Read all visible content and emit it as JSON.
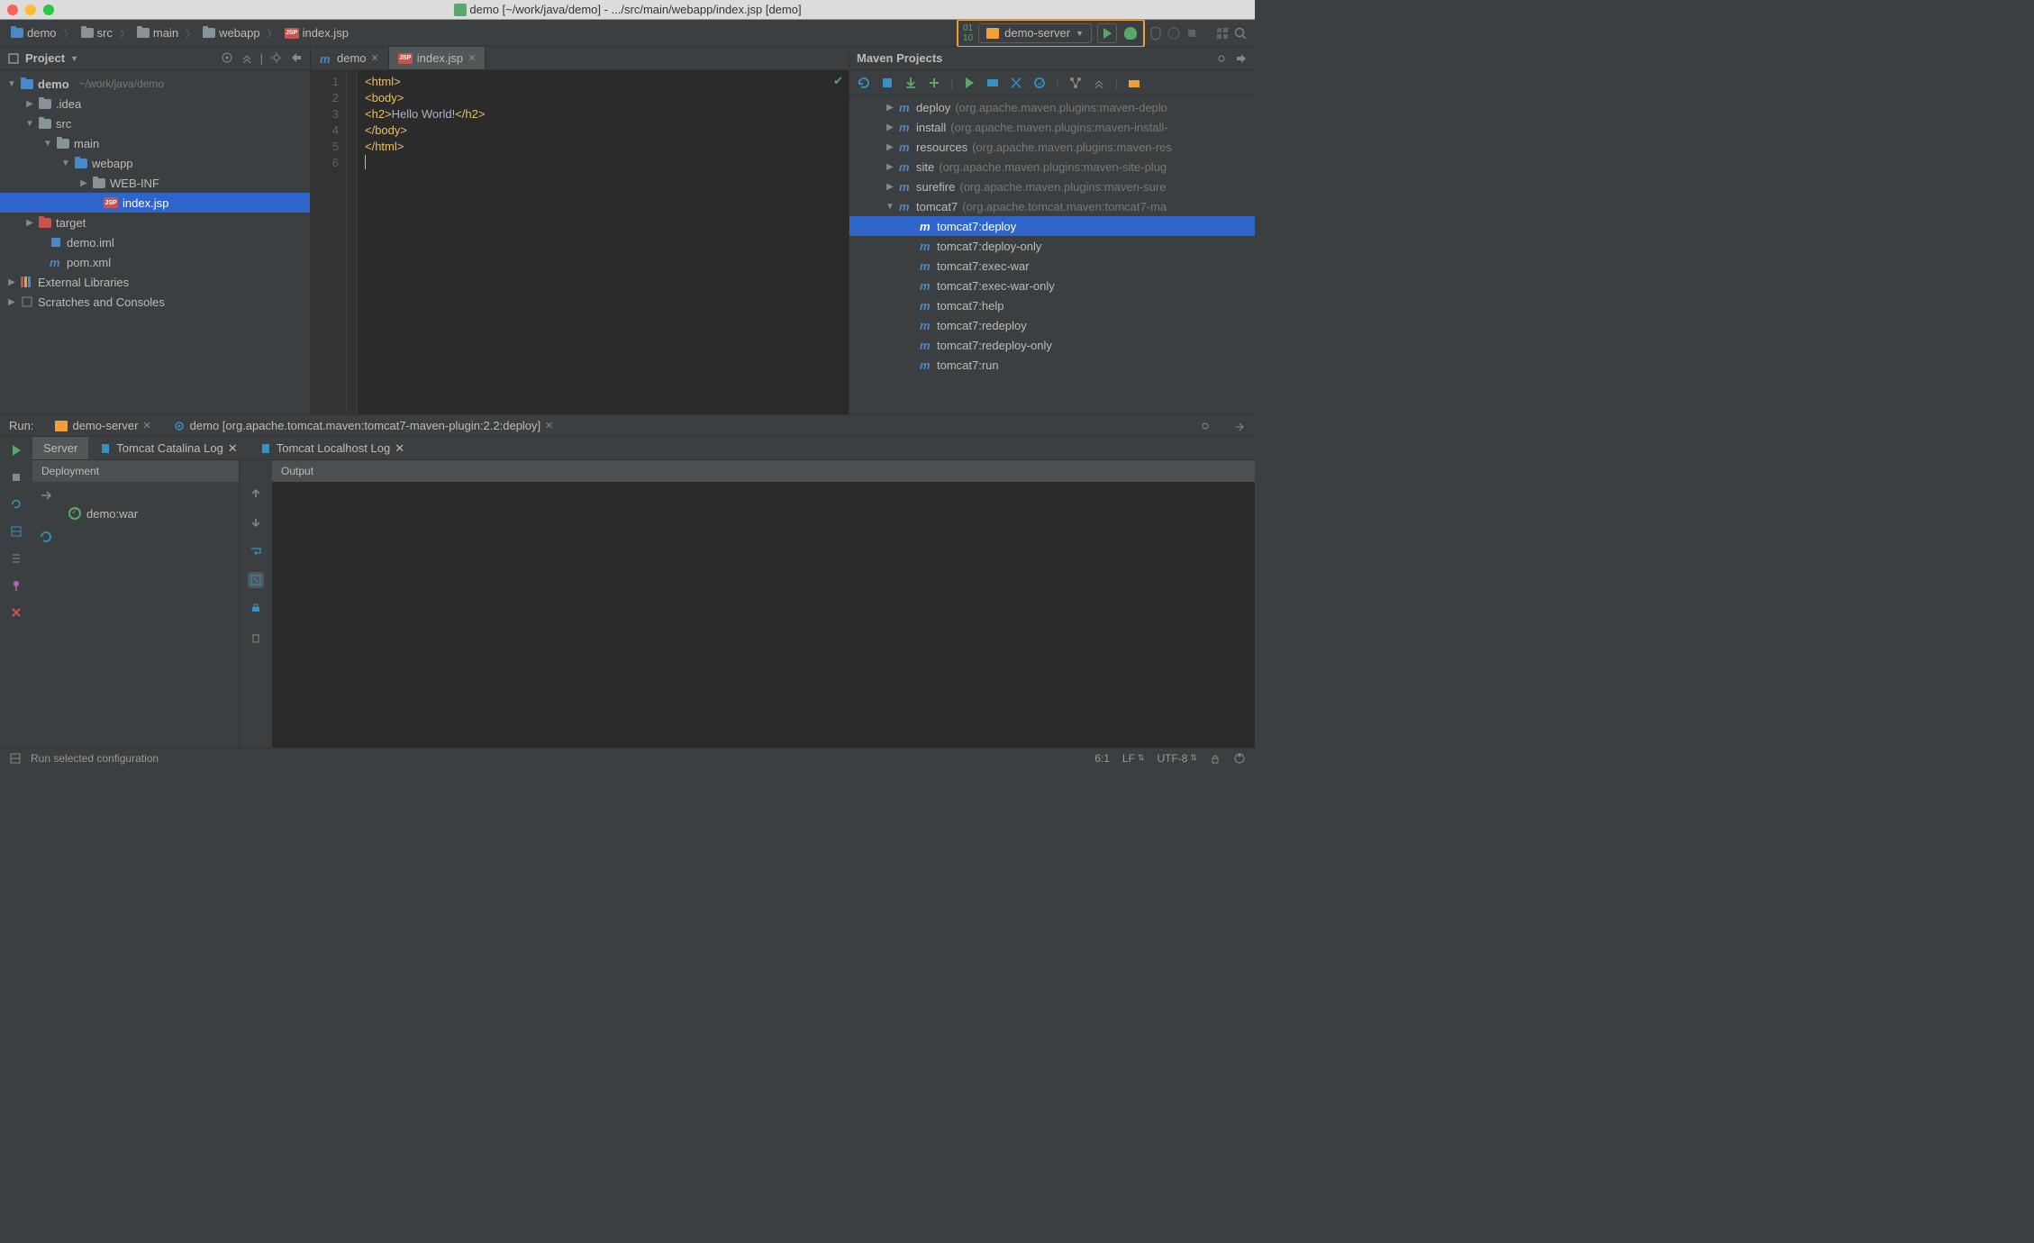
{
  "title": "demo [~/work/java/demo] - .../src/main/webapp/index.jsp [demo]",
  "breadcrumbs": [
    "demo",
    "src",
    "main",
    "webapp",
    "index.jsp"
  ],
  "run_config": {
    "name": "demo-server"
  },
  "project_panel": {
    "title": "Project",
    "tree": {
      "root": {
        "label": "demo",
        "path": "~/work/java/demo"
      },
      "idea": ".idea",
      "src": "src",
      "main": "main",
      "webapp": "webapp",
      "webinf": "WEB-INF",
      "indexjsp": "index.jsp",
      "target": "target",
      "demoiml": "demo.iml",
      "pom": "pom.xml",
      "extlib": "External Libraries",
      "scratches": "Scratches and Consoles"
    }
  },
  "editor": {
    "tabs": [
      {
        "label": "demo",
        "icon": "m"
      },
      {
        "label": "index.jsp",
        "icon": "jsp",
        "active": true
      }
    ],
    "lines": [
      {
        "n": 1,
        "html": "<html>"
      },
      {
        "n": 2,
        "html": "<body>"
      },
      {
        "n": 3,
        "pre": "<h2>",
        "text": "Hello World!",
        "post": "</h2>"
      },
      {
        "n": 4,
        "html": "</body>"
      },
      {
        "n": 5,
        "html": "</html>"
      },
      {
        "n": 6,
        "html": ""
      }
    ]
  },
  "maven": {
    "title": "Maven Projects",
    "items": [
      {
        "name": "deploy",
        "goal": "(org.apache.maven.plugins:maven-deplo"
      },
      {
        "name": "install",
        "goal": "(org.apache.maven.plugins:maven-install-"
      },
      {
        "name": "resources",
        "goal": "(org.apache.maven.plugins:maven-res"
      },
      {
        "name": "site",
        "goal": "(org.apache.maven.plugins:maven-site-plug"
      },
      {
        "name": "surefire",
        "goal": "(org.apache.maven.plugins:maven-sure"
      }
    ],
    "tomcat": {
      "name": "tomcat7",
      "goal": "(org.apache.tomcat.maven:tomcat7-ma"
    },
    "tomcat_goals": [
      "tomcat7:deploy",
      "tomcat7:deploy-only",
      "tomcat7:exec-war",
      "tomcat7:exec-war-only",
      "tomcat7:help",
      "tomcat7:redeploy",
      "tomcat7:redeploy-only",
      "tomcat7:run"
    ]
  },
  "run": {
    "label": "Run:",
    "tabs": [
      {
        "label": "demo-server"
      },
      {
        "label": "demo [org.apache.tomcat.maven:tomcat7-maven-plugin:2.2:deploy]"
      }
    ],
    "subtabs": [
      {
        "label": "Server",
        "active": true
      },
      {
        "label": "Tomcat Catalina Log"
      },
      {
        "label": "Tomcat Localhost Log"
      }
    ],
    "deployment_header": "Deployment",
    "output_header": "Output",
    "deployment_item": "demo:war"
  },
  "status": {
    "hint": "Run selected configuration",
    "position": "6:1",
    "line_sep": "LF",
    "encoding": "UTF-8"
  }
}
